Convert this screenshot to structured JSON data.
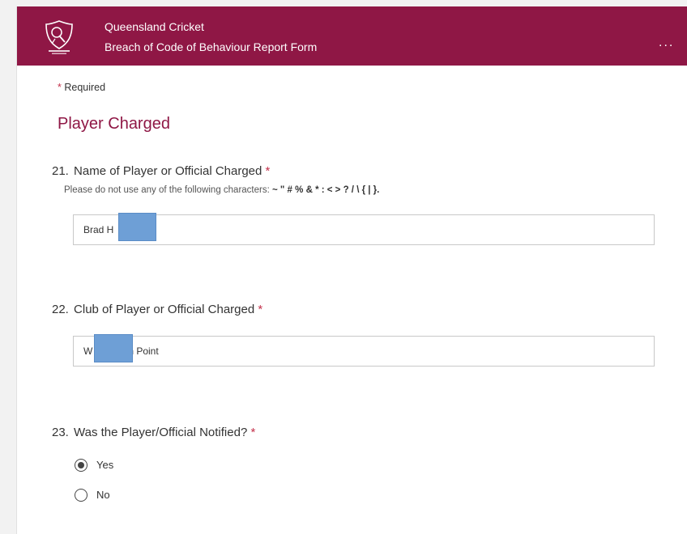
{
  "header": {
    "org_name": "Queensland Cricket",
    "form_title": "Breach of Code of Behaviour Report Form",
    "more_label": "...",
    "logo_text": "QUEENSLAND CRICKET",
    "brand_color": "#8f1745"
  },
  "required_note": {
    "star": "*",
    "text": "Required"
  },
  "section_title": "Player Charged",
  "questions": {
    "q21": {
      "number": "21.",
      "title": "Name of Player or Official Charged",
      "star": "*",
      "hint_prefix": "Please do not use any of the following characters:",
      "hint_chars": "~ \" # % & * : < > ? / \\ { | }.",
      "value": "Brad H"
    },
    "q22": {
      "number": "22.",
      "title": "Club of Player or Official Charged",
      "star": "*",
      "value_start": "W",
      "value_end": "n Point"
    },
    "q23": {
      "number": "23.",
      "title": "Was the Player/Official Notified?",
      "star": "*",
      "options": [
        {
          "label": "Yes",
          "selected": true
        },
        {
          "label": "No",
          "selected": false
        }
      ]
    }
  }
}
